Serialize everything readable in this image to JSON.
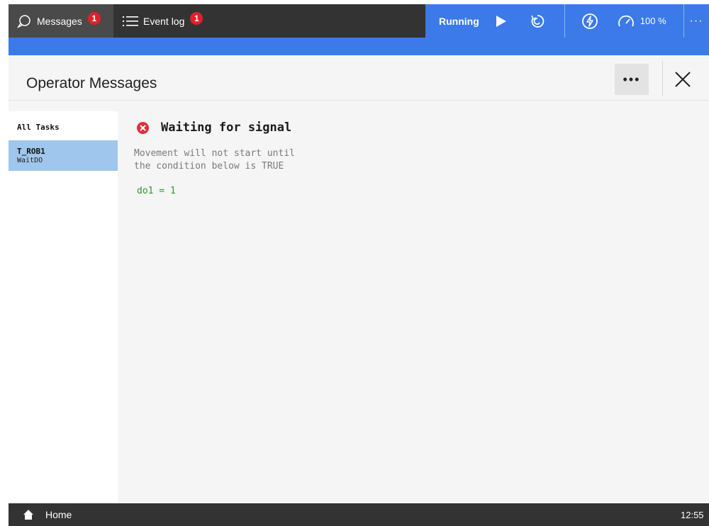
{
  "topbar": {
    "tabs": [
      {
        "label": "Messages",
        "badge": "1",
        "icon": "chat-icon"
      },
      {
        "label": "Event log",
        "badge": "1",
        "icon": "list-icon"
      }
    ],
    "status": {
      "state": "Running",
      "speed": "100 %",
      "icons": [
        "play-icon",
        "cycle-icon",
        "bolt-icon",
        "speedometer-icon",
        "more-icon"
      ]
    },
    "accent_color": "#3b7ae8"
  },
  "header": {
    "title": "Operator Messages",
    "more_label": "•••"
  },
  "tasks": {
    "header": "All Tasks",
    "items": [
      {
        "name": "T_ROB1",
        "instruction": "WaitDO",
        "selected": true
      }
    ]
  },
  "message": {
    "title": "Waiting for signal",
    "body_lines": [
      "Movement will not start until",
      "the condition below is TRUE"
    ],
    "condition": "do1 = 1",
    "severity_icon": "error-icon",
    "severity_color": "#e0303a"
  },
  "bottombar": {
    "home_label": "Home",
    "time": "12:55"
  }
}
